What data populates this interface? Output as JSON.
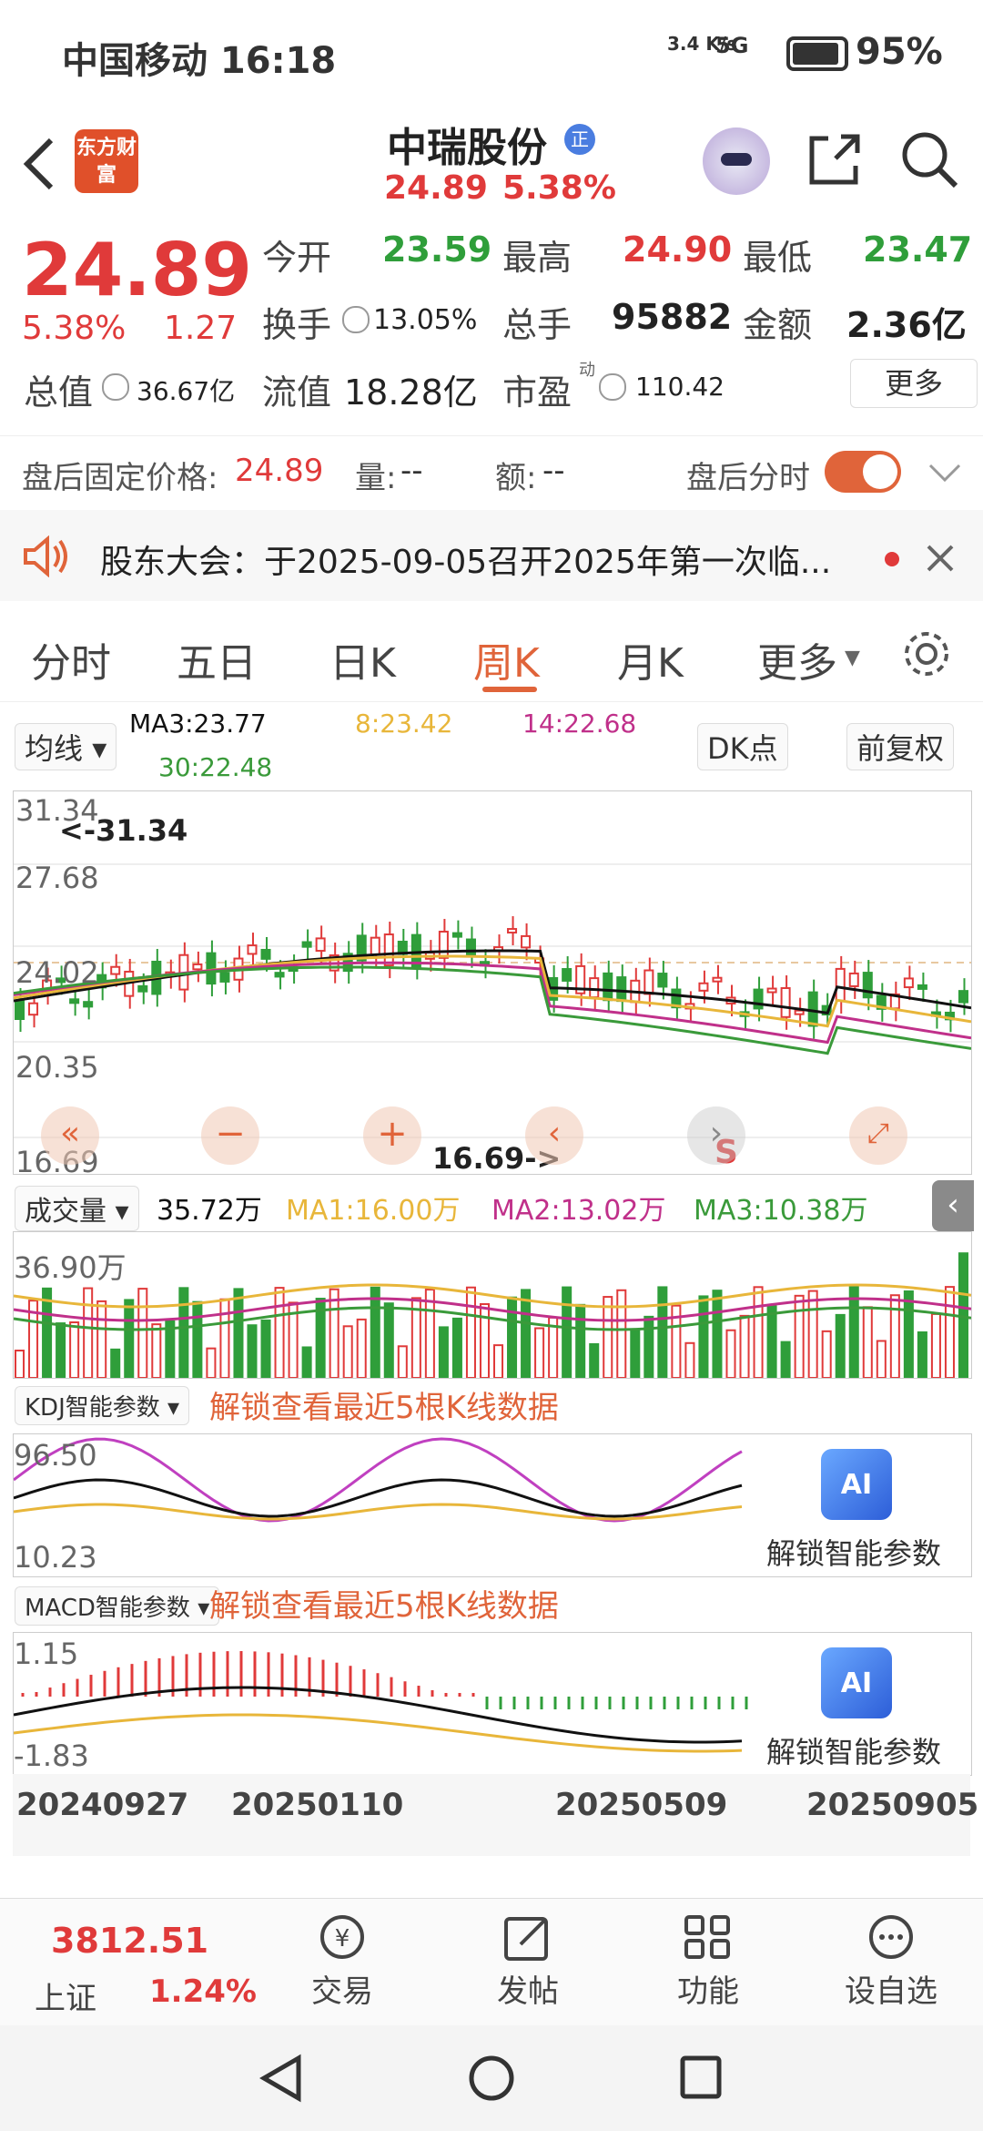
{
  "status_bar": {
    "carrier_time": "中国移动 16:18",
    "network": "3.4 K/s",
    "signal": "5G",
    "battery": "95%"
  },
  "header": {
    "title": "中瑞股份",
    "title_badge": "正",
    "sub_price": "24.89",
    "sub_pct": "5.38%",
    "app_logo": "东方财富"
  },
  "quote": {
    "price": "24.89",
    "pct": "5.38%",
    "change": "1.27",
    "open_label": "今开",
    "open": "23.59",
    "high_label": "最高",
    "high": "24.90",
    "low_label": "最低",
    "low": "23.47",
    "turnover_label": "换手",
    "turnover": "13.05%",
    "volume_label": "总手",
    "volume": "95882",
    "amount_label": "金额",
    "amount": "2.36亿",
    "mktcap_label": "总值",
    "mktcap": "36.67亿",
    "float_label": "流值",
    "float": "18.28亿",
    "pe_label": "市盈",
    "pe_sup": "动",
    "pe": "110.42",
    "more": "更多"
  },
  "after_hours": {
    "price_label": "盘后固定价格:",
    "price": "24.89",
    "vol_label": "量:",
    "vol": "--",
    "amt_label": "额:",
    "amt": "--",
    "toggle_label": "盘后分时"
  },
  "notice": {
    "text": "股东大会：于2025-09-05召开2025年第一次临..."
  },
  "tabs": [
    "分时",
    "五日",
    "日K",
    "周K",
    "月K",
    "更多"
  ],
  "ma_bar": {
    "selector": "均线",
    "ma3": "MA3:23.77",
    "ma8": "8:23.42",
    "ma14": "14:22.68",
    "ma30": "30:22.48",
    "dk": "DK点",
    "fq": "前复权"
  },
  "kline": {
    "y_labels": [
      "31.34",
      "27.68",
      "24.02",
      "20.35",
      "16.69"
    ],
    "high_marker": "<-31.34",
    "low_marker": "16.69->",
    "s_marker": "S"
  },
  "volume_bar": {
    "selector": "成交量",
    "vol": "35.72万",
    "ma1": "MA1:16.00万",
    "ma2": "MA2:13.02万",
    "ma3": "MA3:10.38万",
    "max_label": "36.90万"
  },
  "kdj": {
    "selector": "KDJ智能参数",
    "hint": "解锁查看最近5根K线数据",
    "top": "96.50",
    "bottom": "10.23",
    "unlock": "解锁智能参数"
  },
  "macd": {
    "selector": "MACD智能参数",
    "hint": "解锁查看最近5根K线数据",
    "top": "1.15",
    "bottom": "-1.83",
    "unlock": "解锁智能参数"
  },
  "dates": [
    "20240927",
    "20250110",
    "20250509",
    "20250905"
  ],
  "bottom_nav": {
    "index_value": "3812.51",
    "index_name": "上证",
    "index_pct": "1.24%",
    "items": [
      "交易",
      "发帖",
      "功能",
      "设自选"
    ]
  },
  "colors": {
    "up": "#e03a3a",
    "down": "#2f9e3a",
    "accent": "#e0643a",
    "ma3": "#111111",
    "ma8": "#e8b63a",
    "ma14": "#c0308a",
    "ma30": "#3a9a3a"
  }
}
